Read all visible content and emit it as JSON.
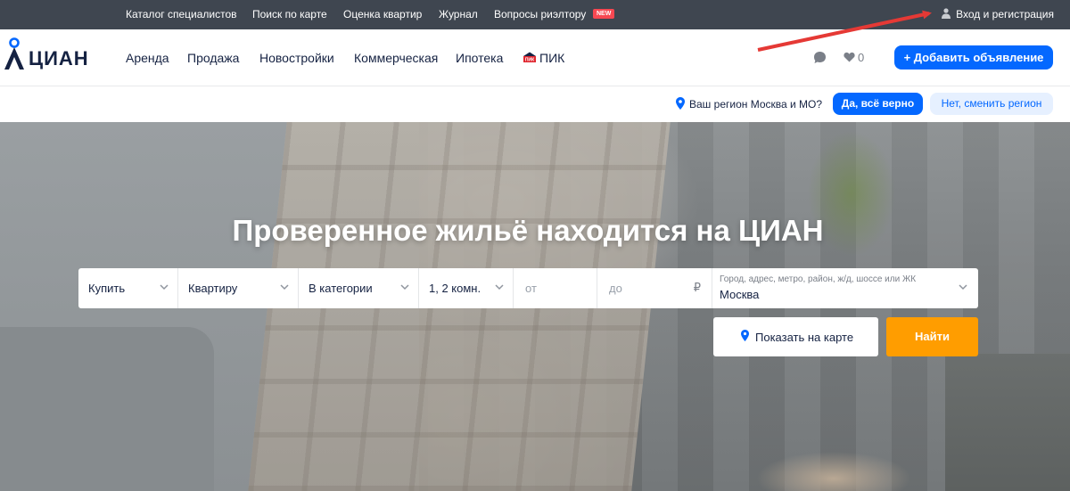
{
  "topbar": {
    "links": [
      "Каталог специалистов",
      "Поиск по карте",
      "Оценка квартир",
      "Журнал",
      "Вопросы риэлтору"
    ],
    "new_badge": "NEW",
    "login": "Вход и регистрация"
  },
  "header": {
    "logo": "ЦИАН",
    "nav": [
      "Аренда",
      "Продажа",
      "Новостройки",
      "Коммерческая",
      "Ипотека",
      "ПИК"
    ],
    "favorites_count": "0",
    "add_button": "+ Добавить объявление"
  },
  "region": {
    "text": "Ваш регион Москва и МО?",
    "yes": "Да, всё верно",
    "no": "Нет, сменить регион"
  },
  "hero": {
    "title": "Проверенное жильё находится на ЦИАН"
  },
  "search": {
    "deal": "Купить",
    "object": "Квартиру",
    "category": "В категории",
    "rooms": "1, 2 комн.",
    "price_from": "от",
    "price_to": "до",
    "currency": "₽",
    "geo_placeholder": "Город, адрес, метро, район, ж/д, шоссе или ЖК",
    "geo_value": "Москва",
    "map_button": "Показать на карте",
    "find_button": "Найти"
  },
  "colors": {
    "brand_blue": "#0468ff",
    "find_orange": "#ff9d00",
    "topbar": "#3f4650",
    "arrow": "#e53935"
  }
}
